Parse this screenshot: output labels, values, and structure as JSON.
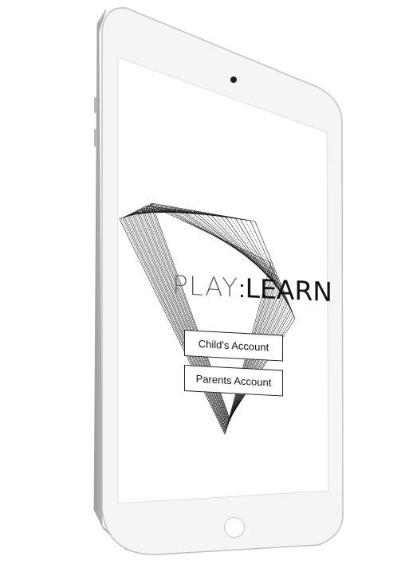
{
  "app": {
    "logo_part1": "PLAY",
    "logo_separator": ":",
    "logo_part2": "LEARN"
  },
  "buttons": {
    "child_account": "Child's Account",
    "parents_account": "Parents Account"
  },
  "colors": {
    "device_body": "#f4f4f4",
    "device_edge": "#c8c8c8",
    "screen": "#ffffff",
    "ink": "#111111"
  },
  "icons": {
    "camera": "front-camera-icon",
    "home": "home-button-icon"
  }
}
